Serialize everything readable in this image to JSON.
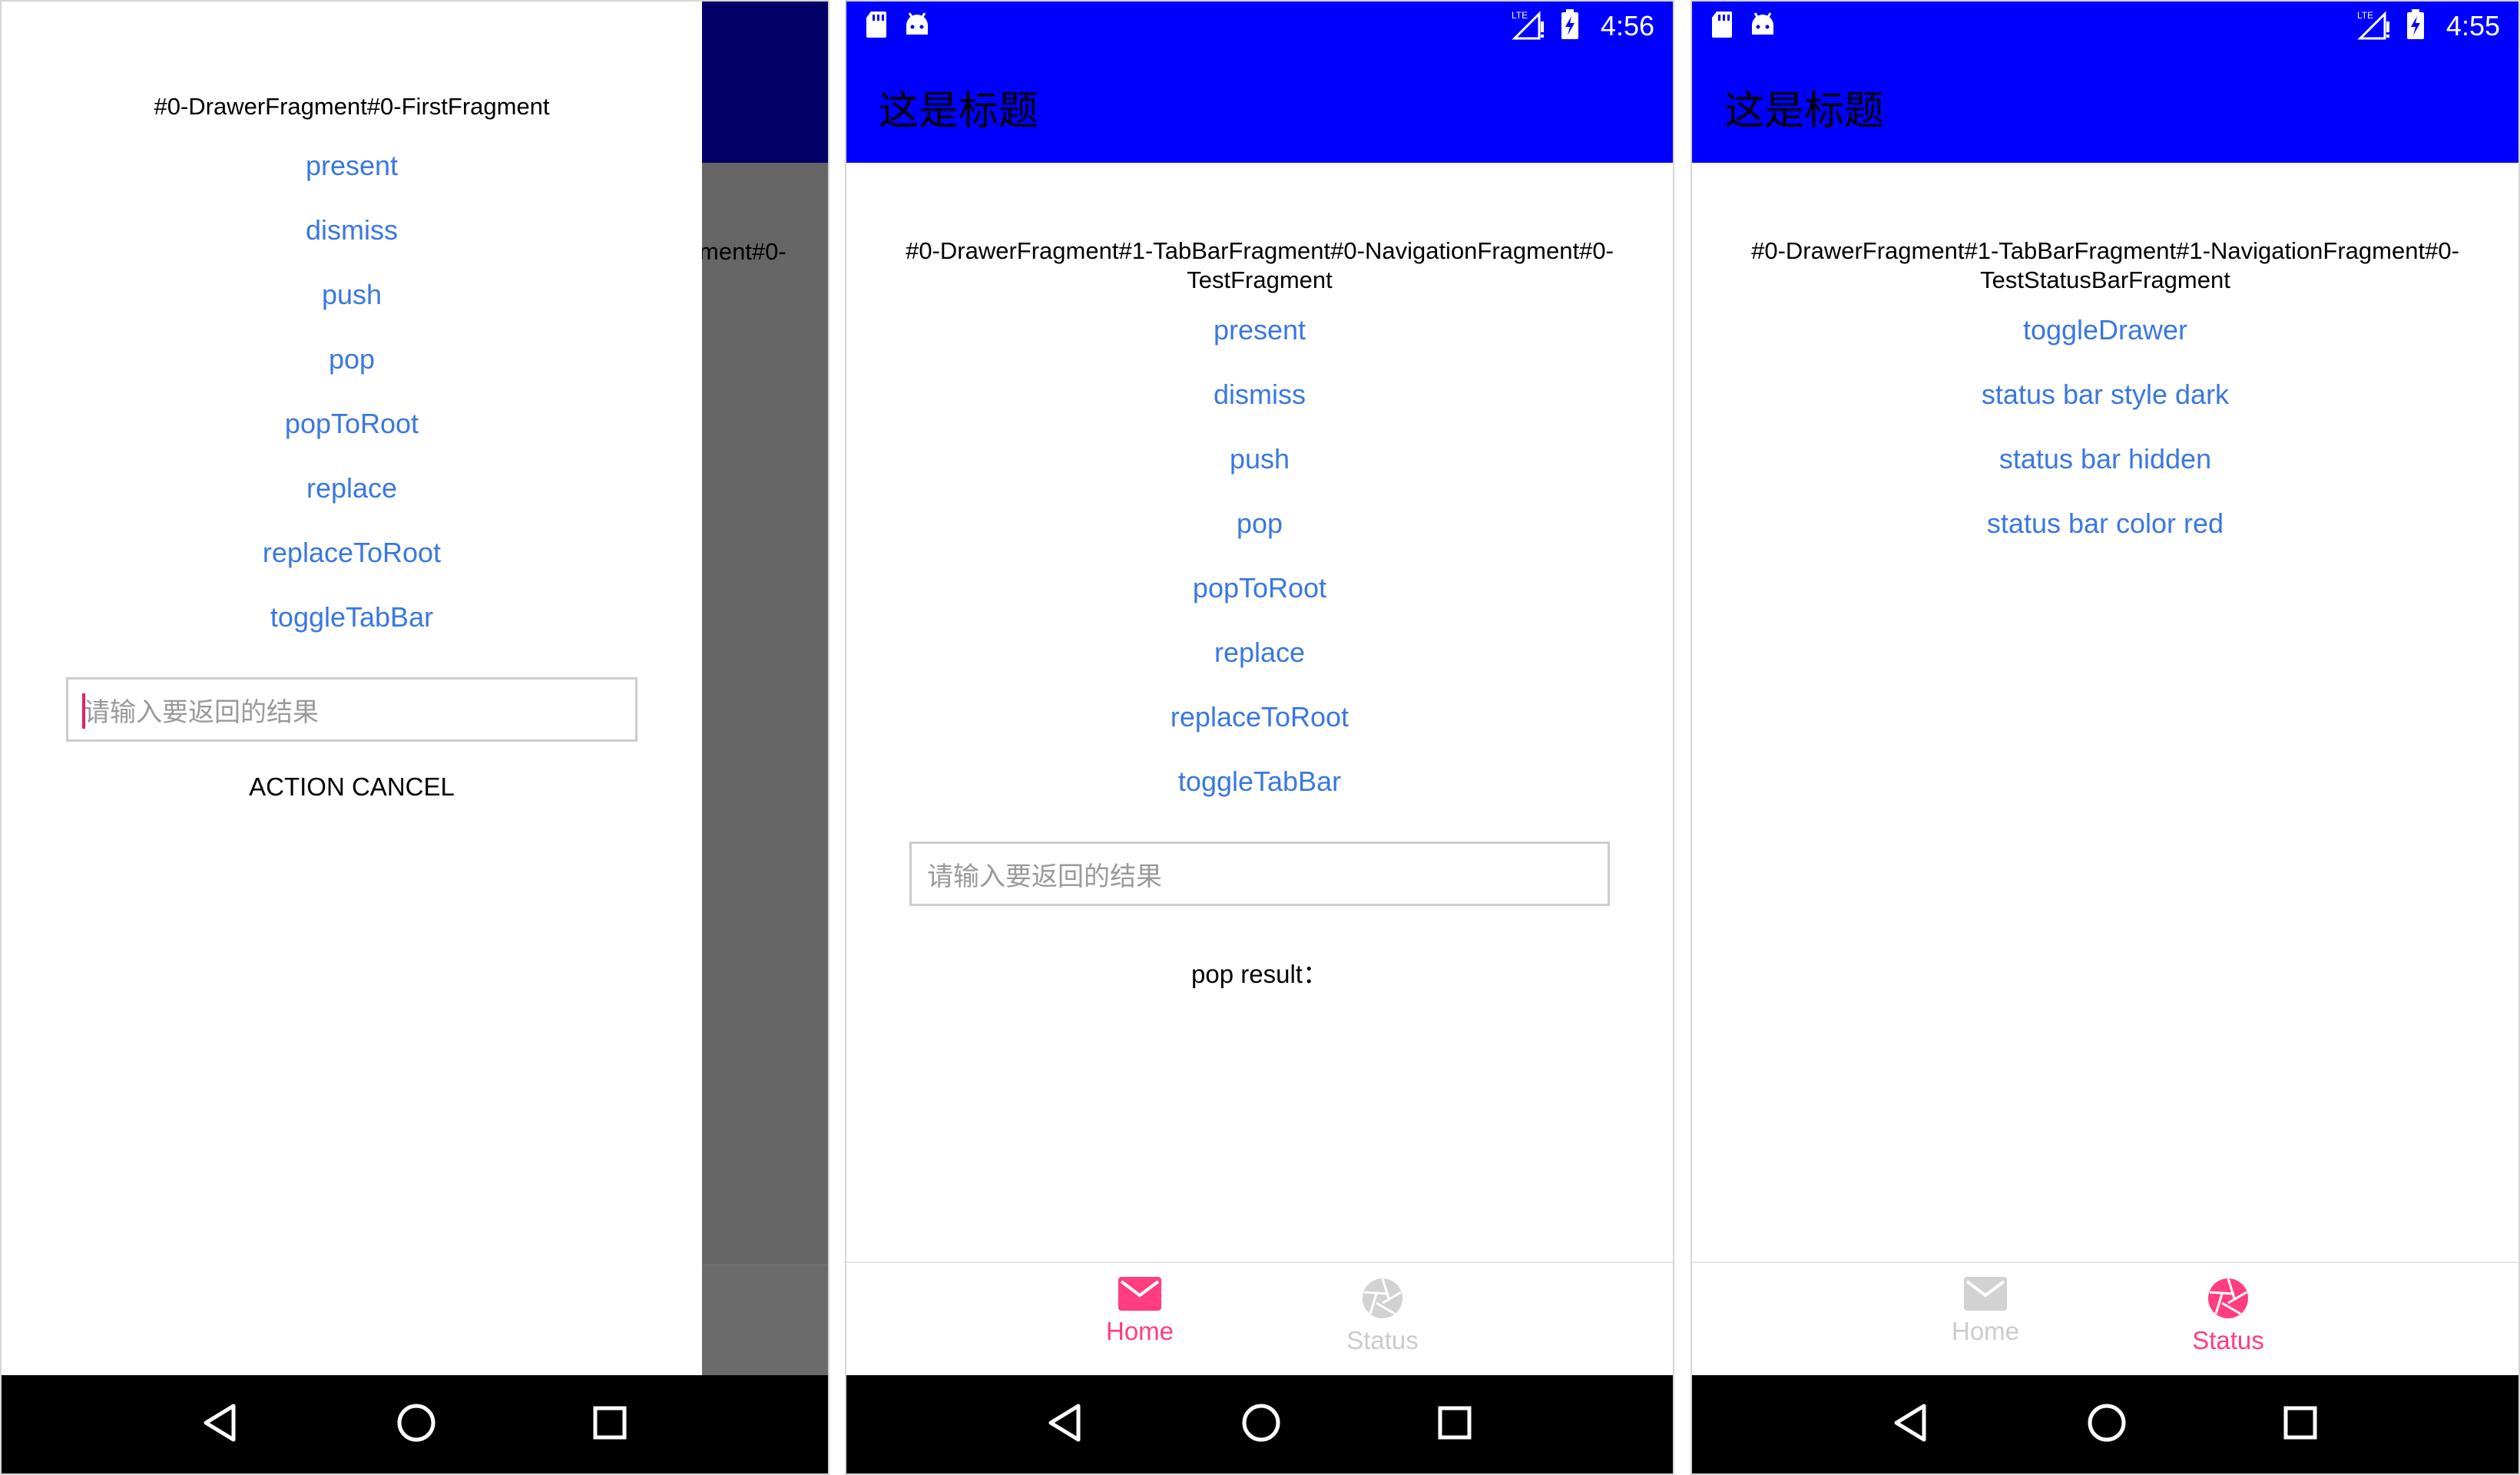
{
  "phone1": {
    "clock": "",
    "peek_text": "ment#0-",
    "drawer": {
      "title": "#0-DrawerFragment#0-FirstFragment",
      "links": [
        "present",
        "dismiss",
        "push",
        "pop",
        "popToRoot",
        "replace",
        "replaceToRoot",
        "toggleTabBar"
      ],
      "input_placeholder": "请输入要返回的结果",
      "action_text": "ACTION CANCEL"
    }
  },
  "phone2": {
    "clock": "4:56",
    "appbar_title": "这是标题",
    "title_line1": "#0-DrawerFragment#1-TabBarFragment#0-NavigationFragment#0-",
    "title_line2": "TestFragment",
    "links": [
      "present",
      "dismiss",
      "push",
      "pop",
      "popToRoot",
      "replace",
      "replaceToRoot",
      "toggleTabBar"
    ],
    "input_placeholder": "请输入要返回的结果",
    "result_text": "pop result：",
    "tabs": [
      {
        "label": "Home",
        "icon": "mail-icon",
        "active": true
      },
      {
        "label": "Status",
        "icon": "aperture-icon",
        "active": false
      }
    ]
  },
  "phone3": {
    "clock": "4:55",
    "appbar_title": "这是标题",
    "title_line1": "#0-DrawerFragment#1-TabBarFragment#1-NavigationFragment#0-",
    "title_line2": "TestStatusBarFragment",
    "links": [
      "toggleDrawer",
      "status bar style dark",
      "status bar hidden",
      "status bar color red"
    ],
    "tabs": [
      {
        "label": "Home",
        "icon": "mail-icon",
        "active": false
      },
      {
        "label": "Status",
        "icon": "aperture-icon",
        "active": true
      }
    ]
  },
  "colors": {
    "appbar": "#0000ff",
    "appbar_dimmed": "#000066",
    "link": "#3a78e0",
    "tab_active": "#ff3d7f",
    "tab_inactive": "#cccccc",
    "navbar": "#000000"
  }
}
